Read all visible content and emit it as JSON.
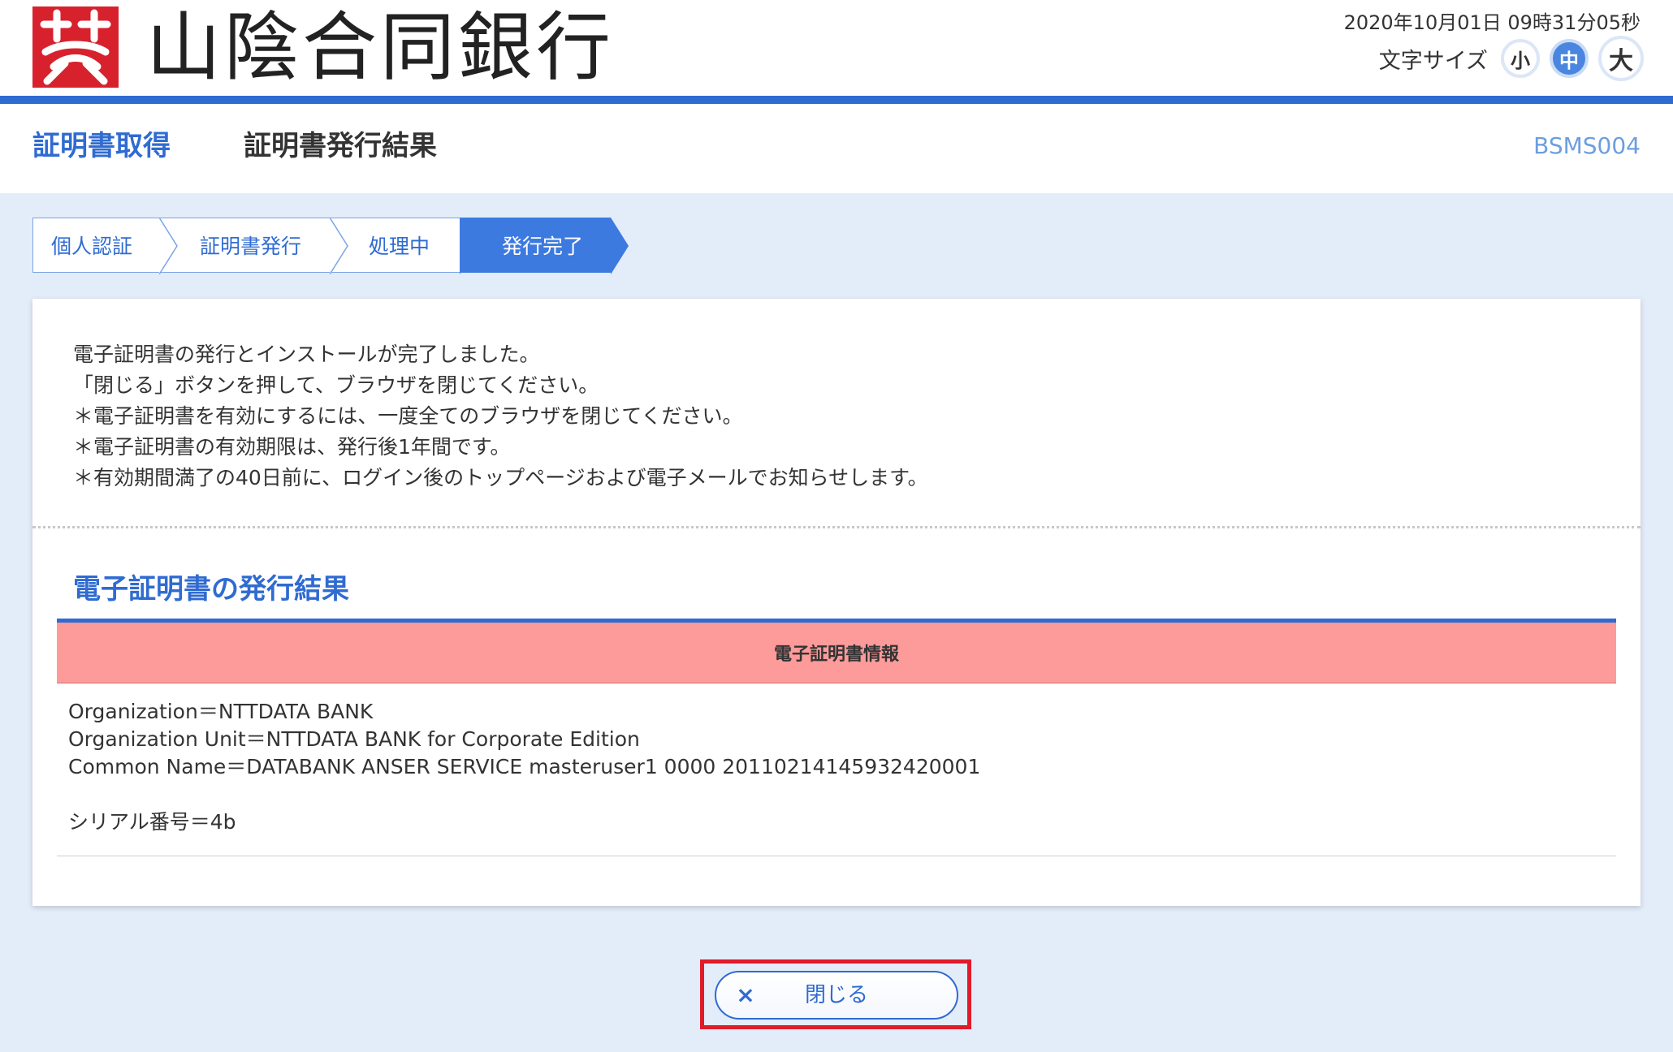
{
  "header": {
    "bank_name": "山陰合同銀行",
    "datetime": "2020年10月01日 09時31分05秒",
    "font_size_label": "文字サイズ",
    "font_size_options": [
      "小",
      "中",
      "大"
    ],
    "font_size_selected": "中",
    "logo_icon": "bank-logo-icon",
    "accent_color": "#2f6bd1",
    "logo_color": "#d7222d"
  },
  "titlebar": {
    "main": "証明書取得",
    "sub": "証明書発行結果",
    "screen_id": "BSMS004"
  },
  "steps": [
    {
      "label": "個人認証",
      "active": false
    },
    {
      "label": "証明書発行",
      "active": false
    },
    {
      "label": "処理中",
      "active": false
    },
    {
      "label": "発行完了",
      "active": true
    }
  ],
  "messages": [
    "電子証明書の発行とインストールが完了しました。",
    "「閉じる」ボタンを押して、ブラウザを閉じてください。",
    "＊電子証明書を有効にするには、一度全てのブラウザを閉じてください。",
    "＊電子証明書の有効期限は、発行後1年間です。",
    "＊有効期間満了の40日前に、ログイン後のトップページおよび電子メールでお知らせします。"
  ],
  "result": {
    "section_title": "電子証明書の発行結果",
    "table_header": "電子証明書情報",
    "lines": [
      "Organization＝NTTDATA BANK",
      "Organization Unit＝NTTDATA BANK for Corporate Edition",
      "Common Name＝DATABANK ANSER SERVICE masteruser1 0000 20110214145932420001",
      "",
      "シリアル番号＝4b"
    ],
    "header_color": "#fd9a9a"
  },
  "close_button": {
    "label": "閉じる",
    "icon": "close-icon",
    "highlight_color": "#e01b2a"
  }
}
